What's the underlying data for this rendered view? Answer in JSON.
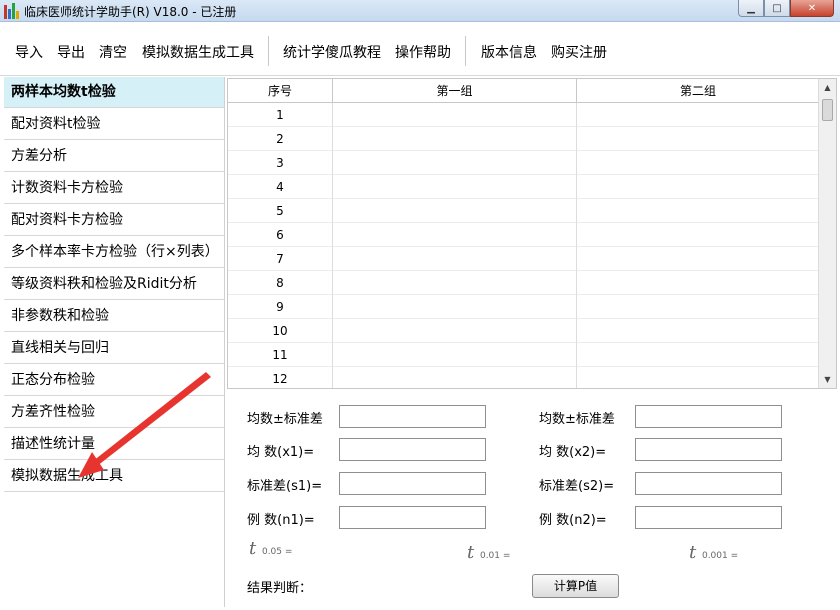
{
  "window": {
    "title": "临床医师统计学助手(R) V18.0 - 已注册",
    "minimize_glyph": "▁",
    "maximize_glyph": "□",
    "close_glyph": "✕"
  },
  "menu": {
    "items": [
      "导入",
      "导出",
      "清空",
      "模拟数据生成工具",
      "统计学傻瓜教程",
      "操作帮助",
      "版本信息",
      "购买注册"
    ]
  },
  "sidebar": {
    "items": [
      "两样本均数t检验",
      "配对资料t检验",
      "方差分析",
      "计数资料卡方检验",
      "配对资料卡方检验",
      "多个样本率卡方检验（行×列表）",
      "等级资料秩和检验及Ridit分析",
      "非参数秩和检验",
      "直线相关与回归",
      "正态分布检验",
      "方差齐性检验",
      "描述性统计量",
      "模拟数据生成工具"
    ],
    "active_index": 0
  },
  "grid": {
    "columns": [
      "序号",
      "第一组",
      "第二组"
    ],
    "rows": [
      "1",
      "2",
      "3",
      "4",
      "5",
      "6",
      "7",
      "8",
      "9",
      "10",
      "11",
      "12"
    ]
  },
  "form": {
    "mean_sd_1": "均数±标准差",
    "mean_1": "均  数(x1)=",
    "sd_1": "标准差(s1)=",
    "n_1": "例  数(n1)=",
    "mean_sd_2": "均数±标准差",
    "mean_2": "均  数(x2)=",
    "sd_2": "标准差(s2)=",
    "n_2": "例  数(n2)=",
    "t_symbol": "t",
    "t005": "0.05 =",
    "t001": "0.01 =",
    "t0001": "0.001 =",
    "result_label": "结果判断：",
    "calc_button": "计算P值"
  },
  "colors": {
    "active_sidebar": "#d6f0f8",
    "arrow": "#e8342e"
  }
}
